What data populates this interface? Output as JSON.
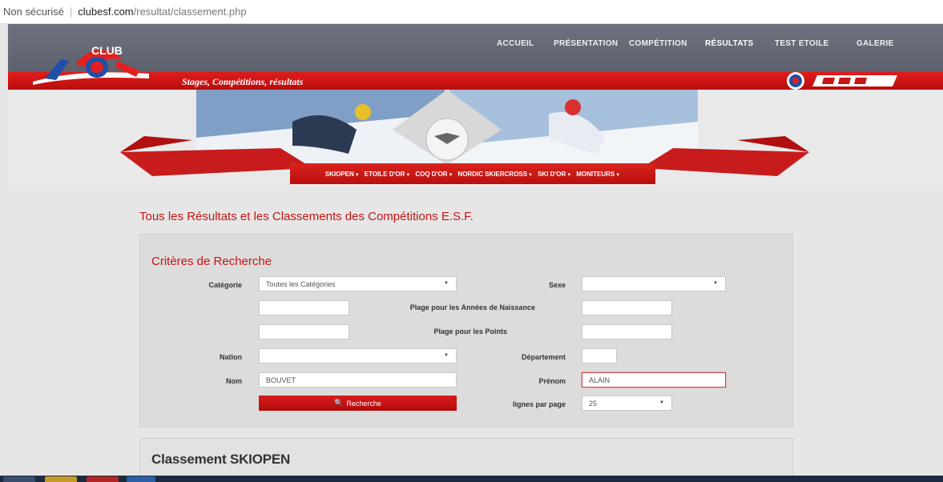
{
  "browser": {
    "security": "Non sécurisé",
    "domain": "clubesf.com",
    "path": "/resultat/classement.php"
  },
  "header": {
    "nav": [
      "ACCUEIL",
      "PRÉSENTATION",
      "COMPÉTITION",
      "RÉSULTATS",
      "TEST ETOILE",
      "GALERIE"
    ],
    "active_nav": "RÉSULTATS",
    "tagline": "Stages, Compétitions, résultats",
    "logo_text": "CLUB",
    "logo_icon": "club-esf-logo",
    "esf_logo_icon": "esf-logo"
  },
  "sub_nav": [
    "SKIOPEN",
    "ETOILE D'OR",
    "COQ D'OR",
    "NORDIC SKIERCROSS",
    "SKI D'OR",
    "MONITEURS"
  ],
  "page_title": "Tous les Résultats et les Classements des Compétitions E.S.F.",
  "search": {
    "title": "Critères de Recherche",
    "labels": {
      "categorie": "Catégorie",
      "sexe": "Sexe",
      "annees": "Plage pour les Années de Naissance",
      "points": "Plage pour les Points",
      "nation": "Nation",
      "departement": "Département",
      "nom": "Nom",
      "prenom": "Prénom",
      "lignes": "lignes par page"
    },
    "values": {
      "categorie": "Toutes les Catégories",
      "sexe": "",
      "nation": "",
      "nom": "BOUVET",
      "prenom": "ALAIN",
      "lignes": "25"
    },
    "button_label": "Recherche",
    "button_icon": "search-icon"
  },
  "results_title": "Classement SKIOPEN",
  "colors": {
    "brand_red": "#c81414",
    "header_gray": "#62666f"
  }
}
